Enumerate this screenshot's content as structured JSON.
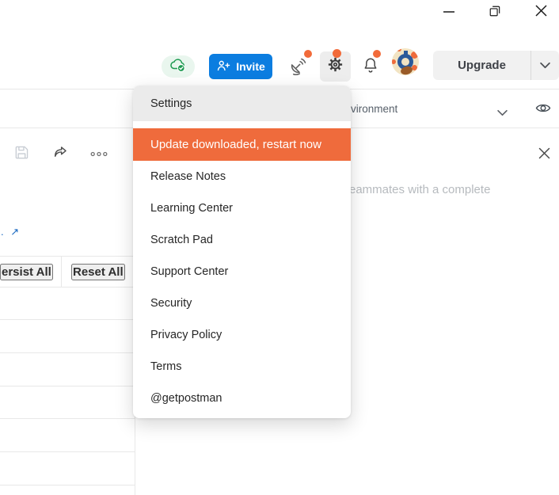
{
  "window": {
    "controls": [
      "minimize",
      "restore",
      "close"
    ]
  },
  "header": {
    "invite_button": "Invite",
    "upgrade_button": "Upgrade",
    "icons": [
      "cloud-sync-check",
      "satellite",
      "settings-gear",
      "bell",
      "avatar"
    ],
    "notification_dot_color": "#f26b3a"
  },
  "environment_bar": {
    "environment_label": "vironment"
  },
  "workspace": {
    "teammates_hint": "eammates with a complete",
    "link_fragment": ".",
    "external_link_arrow": "↗",
    "persist_all_label": "ersist All",
    "reset_all_label": "Reset All"
  },
  "menu": {
    "items": [
      {
        "label": "Settings",
        "state": "highlighted"
      },
      {
        "label": "Update downloaded, restart now",
        "state": "update-accent"
      },
      {
        "label": "Release Notes",
        "state": "normal"
      },
      {
        "label": "Learning Center",
        "state": "normal"
      },
      {
        "label": "Scratch Pad",
        "state": "normal"
      },
      {
        "label": "Support Center",
        "state": "normal"
      },
      {
        "label": "Security",
        "state": "normal"
      },
      {
        "label": "Privacy Policy",
        "state": "normal"
      },
      {
        "label": "Terms",
        "state": "normal"
      },
      {
        "label": "@getpostman",
        "state": "normal"
      }
    ]
  },
  "colors": {
    "accent_orange": "#ef6b3c",
    "invite_blue": "#0b7de0",
    "success_green": "#1d9a50",
    "menu_highlight_gray": "#ebebeb",
    "upgrade_gray": "#f1f1f1"
  }
}
